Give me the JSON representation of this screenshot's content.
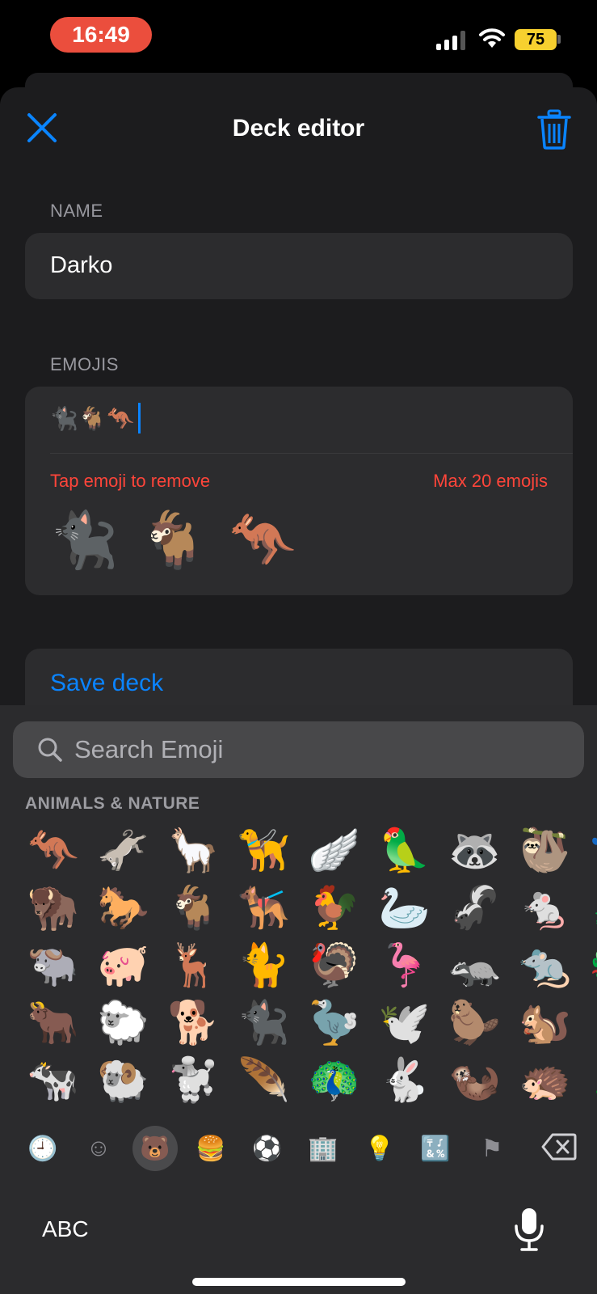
{
  "status_bar": {
    "time": "16:49",
    "battery": "75"
  },
  "header": {
    "title": "Deck editor"
  },
  "name_section": {
    "label": "NAME",
    "value": "Darko"
  },
  "emojis_section": {
    "label": "EMOJIS",
    "input_value": "🐈‍⬛🐐🦘",
    "hint_remove": "Tap emoji to remove",
    "hint_max": "Max 20 emojis",
    "selected": [
      "🐈‍⬛",
      "🐐",
      "🦘"
    ]
  },
  "save_button": {
    "label": "Save deck"
  },
  "keyboard": {
    "search_placeholder": "Search Emoji",
    "category_title": "ANIMALS & NATURE",
    "rows": [
      [
        "🦘",
        "🫏",
        "🦙",
        "🦮",
        "🪽",
        "🦜",
        "🦝",
        "🦥",
        "🐾"
      ],
      [
        "🦬",
        "🐎",
        "🐐",
        "🐕‍🦺",
        "🐓",
        "🦢",
        "🦨",
        "🐁",
        "🐉"
      ],
      [
        "🐃",
        "🐖",
        "🦌",
        "🐈",
        "🦃",
        "🦩",
        "🦡",
        "🐀",
        "🐲"
      ],
      [
        "🐂",
        "🐑",
        "🐕",
        "🐈‍⬛",
        "🦤",
        "🕊️",
        "🦫",
        "🐿️",
        "🌵"
      ],
      [
        "🐄",
        "🐏",
        "🐩",
        "🪶",
        "🦚",
        "🐇",
        "🦦",
        "🦔",
        "🎄"
      ]
    ],
    "categories": [
      {
        "name": "recent",
        "glyph": "🕘"
      },
      {
        "name": "smileys",
        "glyph": "☺"
      },
      {
        "name": "animals",
        "glyph": "🐻"
      },
      {
        "name": "food",
        "glyph": "🍔"
      },
      {
        "name": "activity",
        "glyph": "⚽"
      },
      {
        "name": "travel",
        "glyph": "🏢"
      },
      {
        "name": "objects",
        "glyph": "💡"
      },
      {
        "name": "symbols",
        "glyph": "🔣"
      },
      {
        "name": "flags",
        "glyph": "⚑"
      }
    ],
    "abc_label": "ABC"
  },
  "colors": {
    "accent": "#0a84ff",
    "danger": "#ff453a",
    "time_pill": "#eb4e3d",
    "battery": "#f7d02f"
  }
}
